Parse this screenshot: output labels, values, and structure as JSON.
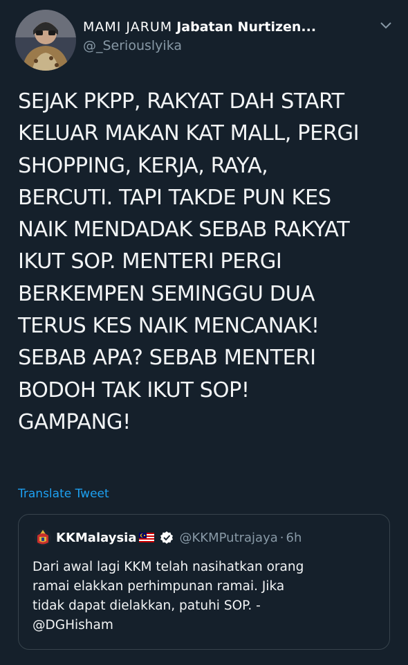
{
  "tweet": {
    "display_name_plain": "MAMI JARUM",
    "display_name_bold": "Jabatan Nurtizen...",
    "handle": "@_Seriouslyika",
    "body": "SEJAK PKPP, RAKYAT DAH START\nKELUAR MAKAN KAT MALL, PERGI\nSHOPPING, KERJA, RAYA,\nBERCUTI. TAPI TAKDE PUN KES\nNAIK MENDADAK SEBAB RAKYAT\nIKUT SOP. MENTERI PERGI\nBERKEMPEN SEMINGGU DUA\nTERUS KES NAIK MENCANAK!\nSEBAB APA? SEBAB MENTERI\nBODOH TAK IKUT SOP!\nGAMPANG!",
    "translate_label": "Translate Tweet",
    "icons": {
      "avatar": "avatar-photo",
      "menu": "chevron-down-icon"
    }
  },
  "quote": {
    "name": "KKMalaysia",
    "handle": "@KKMPutrajaya",
    "separator": "·",
    "time": "6h",
    "text": "Dari awal lagi KKM telah nasihatkan orang\nramai elakkan perhimpunan ramai. Jika\ntidak dapat dielakkan, patuhi SOP. -\n@DGHisham",
    "icons": {
      "logo": "kkm-logo-icon",
      "flag": "malaysia-flag-icon",
      "verified": "verified-badge-icon"
    }
  },
  "colors": {
    "background": "#15202b",
    "text": "#f2f4f5",
    "muted": "#8899a6",
    "link": "#1da1f2",
    "border": "#38444d"
  }
}
